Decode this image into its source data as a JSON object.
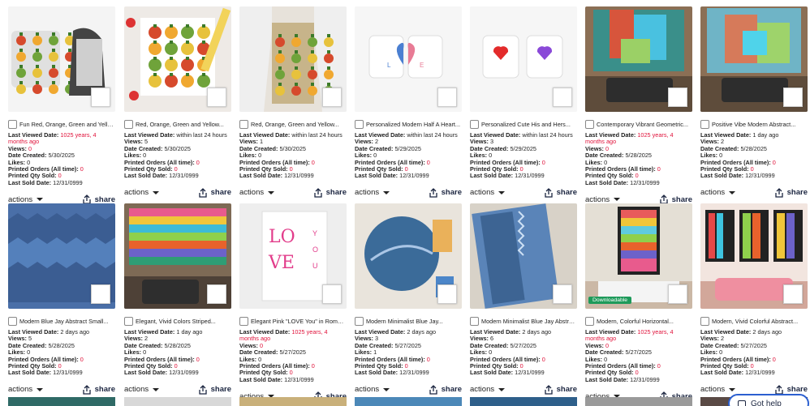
{
  "labels": {
    "last_viewed": "Last Viewed Date:",
    "views": "Views:",
    "date_created": "Date Created:",
    "likes": "Likes:",
    "printed_orders": "Printed Orders (All time):",
    "printed_qty": "Printed Qty Sold:",
    "last_sold": "Last Sold Date:",
    "actions": "actions",
    "share": "share"
  },
  "help_button": "Got help",
  "products": [
    {
      "title": "Fun Red, Orange, Green and Yello...",
      "last_viewed": "1025 years, 4 months ago",
      "last_viewed_red": true,
      "views": "0",
      "views_red": true,
      "date_created": "5/30/2025",
      "likes": "0",
      "printed_orders": "0",
      "printed_qty": "0",
      "last_sold": "12/31/0999"
    },
    {
      "title": "Red, Orange, Green and Yellow...",
      "last_viewed": "within last 24 hours",
      "last_viewed_red": false,
      "views": "5",
      "views_red": false,
      "date_created": "5/30/2025",
      "likes": "0",
      "printed_orders": "0",
      "printed_qty": "0",
      "last_sold": "12/31/0999"
    },
    {
      "title": "Red, Orange, Green and Yellow...",
      "last_viewed": "within last 24 hours",
      "last_viewed_red": false,
      "views": "1",
      "views_red": false,
      "date_created": "5/30/2025",
      "likes": "0",
      "printed_orders": "0",
      "printed_qty": "0",
      "last_sold": "12/31/0999"
    },
    {
      "title": "Personalized Modern Half A Heart...",
      "last_viewed": "within last 24 hours",
      "last_viewed_red": false,
      "views": "2",
      "views_red": false,
      "date_created": "5/29/2025",
      "likes": "0",
      "printed_orders": "0",
      "printed_qty": "0",
      "last_sold": "12/31/0999"
    },
    {
      "title": "Personalized Cute His and Hers...",
      "last_viewed": "within last 24 hours",
      "last_viewed_red": false,
      "views": "3",
      "views_red": false,
      "date_created": "5/29/2025",
      "likes": "0",
      "printed_orders": "0",
      "printed_qty": "0",
      "last_sold": "12/31/0999"
    },
    {
      "title": "Contemporary Vibrant Geometric...",
      "last_viewed": "1025 years, 4 months ago",
      "last_viewed_red": true,
      "views": "0",
      "views_red": true,
      "date_created": "5/28/2025",
      "likes": "0",
      "printed_orders": "0",
      "printed_qty": "0",
      "last_sold": "12/31/0999"
    },
    {
      "title": "Positive Vibe Modern Abstract...",
      "last_viewed": "1 day ago",
      "last_viewed_red": false,
      "views": "2",
      "views_red": false,
      "date_created": "5/28/2025",
      "likes": "0",
      "printed_orders": "0",
      "printed_qty": "0",
      "last_sold": "12/31/0999"
    },
    {
      "title": "Modern Blue Jay Abstract Small...",
      "last_viewed": "2 days ago",
      "last_viewed_red": false,
      "views": "5",
      "views_red": false,
      "date_created": "5/28/2025",
      "likes": "0",
      "printed_orders": "0",
      "printed_qty": "0",
      "last_sold": "12/31/0999"
    },
    {
      "title": "Elegant, Vivid Colors Striped...",
      "last_viewed": "1 day ago",
      "last_viewed_red": false,
      "views": "2",
      "views_red": false,
      "date_created": "5/28/2025",
      "likes": "0",
      "printed_orders": "0",
      "printed_qty": "0",
      "last_sold": "12/31/0999"
    },
    {
      "title": "Elegant Pink \"LOVE You\" in Roman...",
      "last_viewed": "1025 years, 4 months ago",
      "last_viewed_red": true,
      "views": "0",
      "views_red": true,
      "date_created": "5/27/2025",
      "likes": "0",
      "printed_orders": "0",
      "printed_qty": "0",
      "last_sold": "12/31/0999"
    },
    {
      "title": "Modern Minimalist Blue Jay...",
      "last_viewed": "2 days ago",
      "last_viewed_red": false,
      "views": "3",
      "views_red": false,
      "date_created": "5/27/2025",
      "likes": "1",
      "printed_orders": "0",
      "printed_qty": "0",
      "last_sold": "12/31/0999"
    },
    {
      "title": "Modern Minimalist Blue Jay Abstract...",
      "last_viewed": "2 days ago",
      "last_viewed_red": false,
      "views": "6",
      "views_red": false,
      "date_created": "5/27/2025",
      "likes": "0",
      "printed_orders": "0",
      "printed_qty": "0",
      "last_sold": "12/31/0999"
    },
    {
      "title": "Modern, Colorful Horizontal...",
      "last_viewed": "1025 years, 4 months ago",
      "last_viewed_red": true,
      "views": "0",
      "views_red": true,
      "date_created": "5/27/2025",
      "likes": "0",
      "printed_orders": "0",
      "printed_qty": "0",
      "last_sold": "12/31/0999",
      "badge": "Downloadable"
    },
    {
      "title": "Modern, Vivid Colorful Abstract...",
      "last_viewed": "2 days ago",
      "last_viewed_red": false,
      "views": "2",
      "views_red": false,
      "date_created": "5/27/2025",
      "likes": "0",
      "printed_orders": "0",
      "printed_qty": "0",
      "last_sold": "12/31/0999"
    }
  ]
}
